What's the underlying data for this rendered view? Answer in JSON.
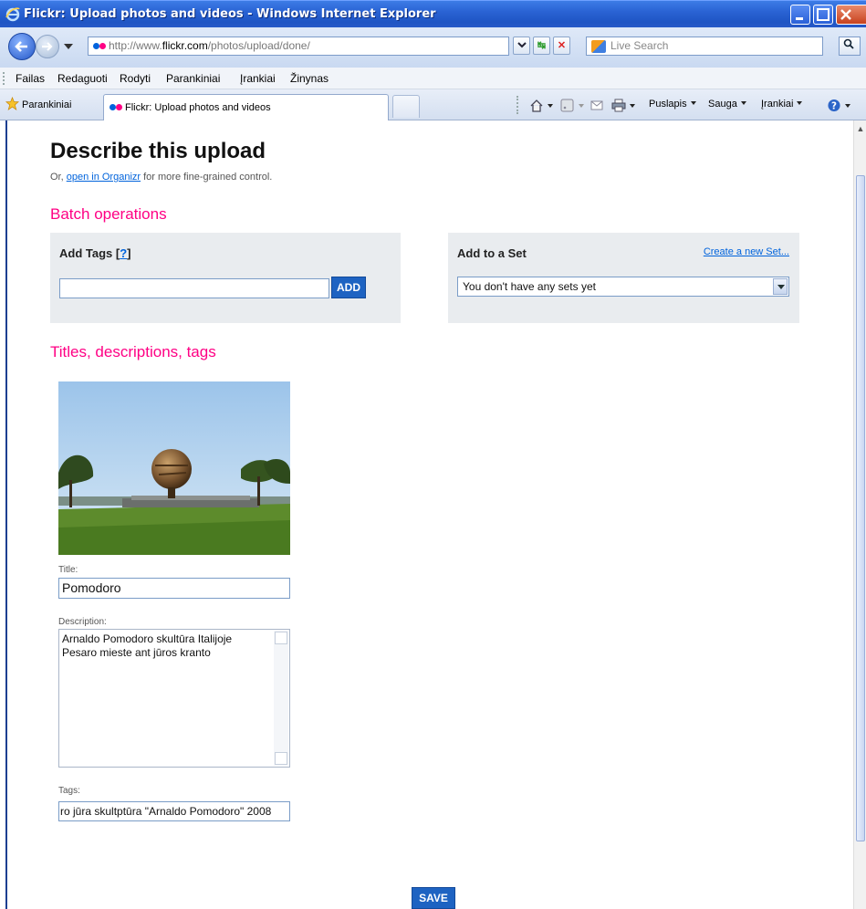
{
  "window": {
    "title": "Flickr: Upload photos and videos - Windows Internet Explorer"
  },
  "address": {
    "url_prefix": "http://www.",
    "url_host": "flickr.com",
    "url_path": "/photos/upload/done/",
    "search_placeholder": "Live Search"
  },
  "menu": [
    "Failas",
    "Redaguoti",
    "Rodyti",
    "Parankiniai",
    "Įrankiai",
    "Žinynas"
  ],
  "favorites": {
    "label": "Parankiniai"
  },
  "tab": {
    "label": "Flickr: Upload photos and videos"
  },
  "toolbar": {
    "page": "Puslapis",
    "safety": "Sauga",
    "tools": "Įrankiai"
  },
  "page": {
    "heading": "Describe this upload",
    "sub_prefix": "Or, ",
    "sub_link": "open in Organizr",
    "sub_suffix": " for more fine-grained control.",
    "batch_heading": "Batch operations",
    "add_tags": {
      "label": "Add Tags",
      "help_open": " [",
      "help_link": "?",
      "help_close": "]",
      "button": "ADD"
    },
    "add_set": {
      "label": "Add to a Set",
      "create_link": "Create a new Set...",
      "selected": "You don't have any sets yet"
    },
    "titles_heading": "Titles, descriptions, tags",
    "photo": {
      "title_label": "Title:",
      "title_value": "Pomodoro",
      "description_label": "Description:",
      "description_line1": "Arnaldo Pomodoro skultūra Italijoje",
      "description_line2": "Pesaro mieste ant jūros kranto",
      "tags_label": "Tags:",
      "tags_value": "ro jūra skultptūra \"Arnaldo Pomodoro\" 2008"
    },
    "save_button": "SAVE"
  },
  "colors": {
    "flickr_pink": "#ff0084",
    "flickr_blue": "#0063dc",
    "button_blue": "#1e63c2"
  }
}
